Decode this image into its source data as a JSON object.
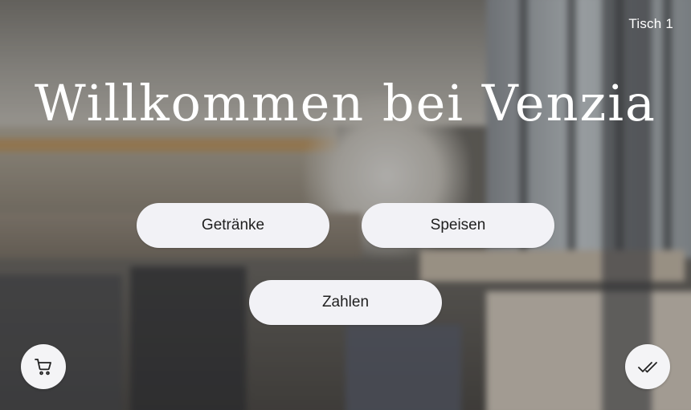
{
  "header": {
    "table_label": "Tisch 1"
  },
  "hero": {
    "title": "Willkommen bei Venzia"
  },
  "menu": {
    "drinks_label": "Getränke",
    "food_label": "Speisen",
    "pay_label": "Zahlen"
  },
  "actions": {
    "cart_icon": "cart-icon",
    "confirm_icon": "double-check-icon"
  },
  "colors": {
    "button_bg": "#f2f2f6",
    "button_text": "#1f1f1f",
    "title_text": "#ffffff"
  }
}
